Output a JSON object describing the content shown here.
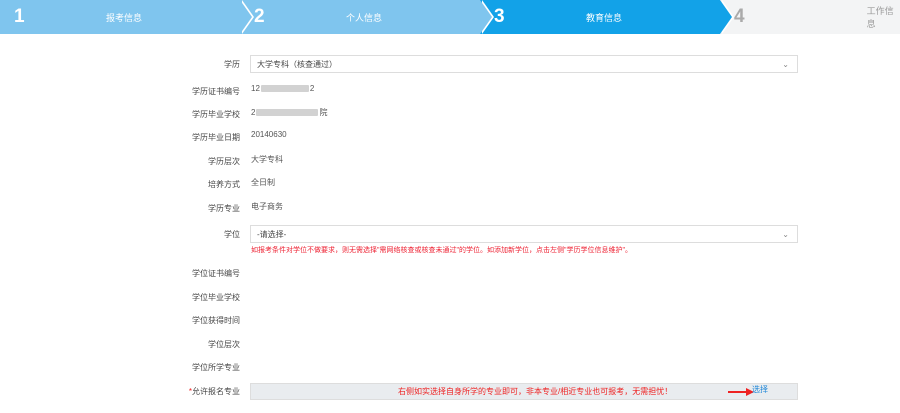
{
  "steps": [
    {
      "num": "1",
      "label": "报考信息"
    },
    {
      "num": "2",
      "label": "个人信息"
    },
    {
      "num": "3",
      "label": "教育信息"
    },
    {
      "num": "4",
      "label": "工作信息"
    }
  ],
  "form": {
    "education": {
      "label": "学历",
      "value": "大学专科（核查通过）"
    },
    "cert_no": {
      "label": "学历证书编号",
      "value_prefix": "12",
      "value_suffix": "2"
    },
    "school": {
      "label": "学历毕业学校",
      "value_prefix": "2",
      "value_suffix": "院"
    },
    "grad_date": {
      "label": "学历毕业日期",
      "value": "20140630"
    },
    "level": {
      "label": "学历层次",
      "value": "大学专科"
    },
    "study_mode": {
      "label": "培养方式",
      "value": "全日制"
    },
    "major": {
      "label": "学历专业",
      "value": "电子商务"
    },
    "degree": {
      "label": "学位",
      "placeholder": "-请选择-"
    },
    "degree_warning": "如报考条件对学位不做要求，则无需选择\"需网络核查或核查未通过\"的学位。如添加新学位，点击左侧\"学历学位信息维护\"。",
    "degree_cert_no": {
      "label": "学位证书编号"
    },
    "degree_school": {
      "label": "学位毕业学校"
    },
    "degree_date": {
      "label": "学位获得时间"
    },
    "degree_level": {
      "label": "学位层次"
    },
    "degree_major": {
      "label": "学位所学专业"
    },
    "allowed_major": {
      "required_mark": "*",
      "label": "允许报名专业",
      "note": "右侧如实选择自身所学的专业即可，非本专业/相近专业也可报考，无需担忧！",
      "link": "选择"
    }
  },
  "colors": {
    "step_active": "#12a2e8",
    "step_done": "#7fc5ee",
    "warn": "#e22222",
    "link": "#1d86d8"
  }
}
